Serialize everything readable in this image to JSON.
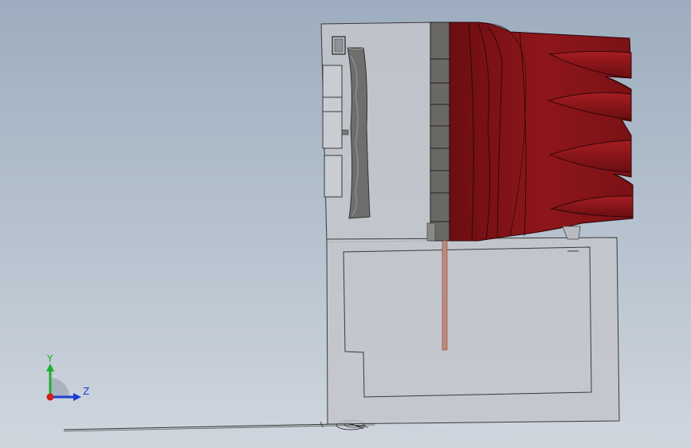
{
  "triad": {
    "y_label": "Y",
    "z_label": "Z",
    "colors": {
      "y": "#1fae2c",
      "z": "#1c3fd0",
      "x": "#d01c1c"
    }
  },
  "colors": {
    "background_top": "#9dadbf",
    "background_bottom": "#cfd6de",
    "housing_fill": "#c3c6cb",
    "edge": "#3a3a3a",
    "ribbed_part": "#7a1216",
    "ribbed_part_highlight": "#9a1a1e",
    "connector_strip": "#6a6862",
    "rod": "#c08a78"
  }
}
